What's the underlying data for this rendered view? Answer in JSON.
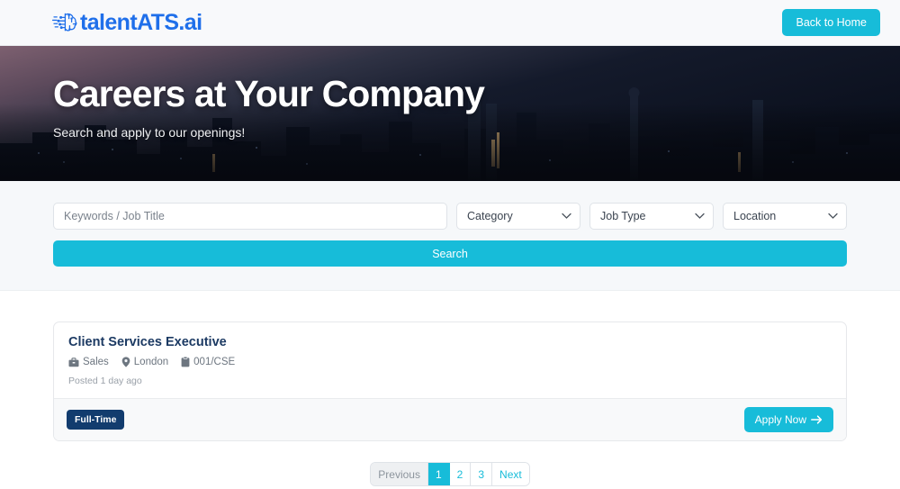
{
  "header": {
    "brand_icon": "circuit-brain-icon",
    "brand_name": "talentATS.ai",
    "back_home_label": "Back to Home",
    "brand_color": "#1f6fea",
    "accent_color": "#17bcd9"
  },
  "hero": {
    "title": "Careers at Your Company",
    "subtitle": "Search and apply to our openings!"
  },
  "search": {
    "keywords_placeholder": "Keywords / Job Title",
    "category_label": "Category",
    "job_type_label": "Job Type",
    "location_label": "Location",
    "search_button_label": "Search"
  },
  "jobs": [
    {
      "title": "Client Services Executive",
      "department": "Sales",
      "department_icon": "briefcase-icon",
      "location": "London",
      "location_icon": "map-pin-icon",
      "reference": "001/CSE",
      "reference_icon": "clipboard-icon",
      "posted": "Posted 1 day ago",
      "employment_type": "Full-Time",
      "apply_label": "Apply Now",
      "apply_icon": "arrow-right-icon"
    }
  ],
  "pagination": {
    "previous_label": "Previous",
    "pages": [
      "1",
      "2",
      "3"
    ],
    "next_label": "Next",
    "current_page": "1"
  }
}
